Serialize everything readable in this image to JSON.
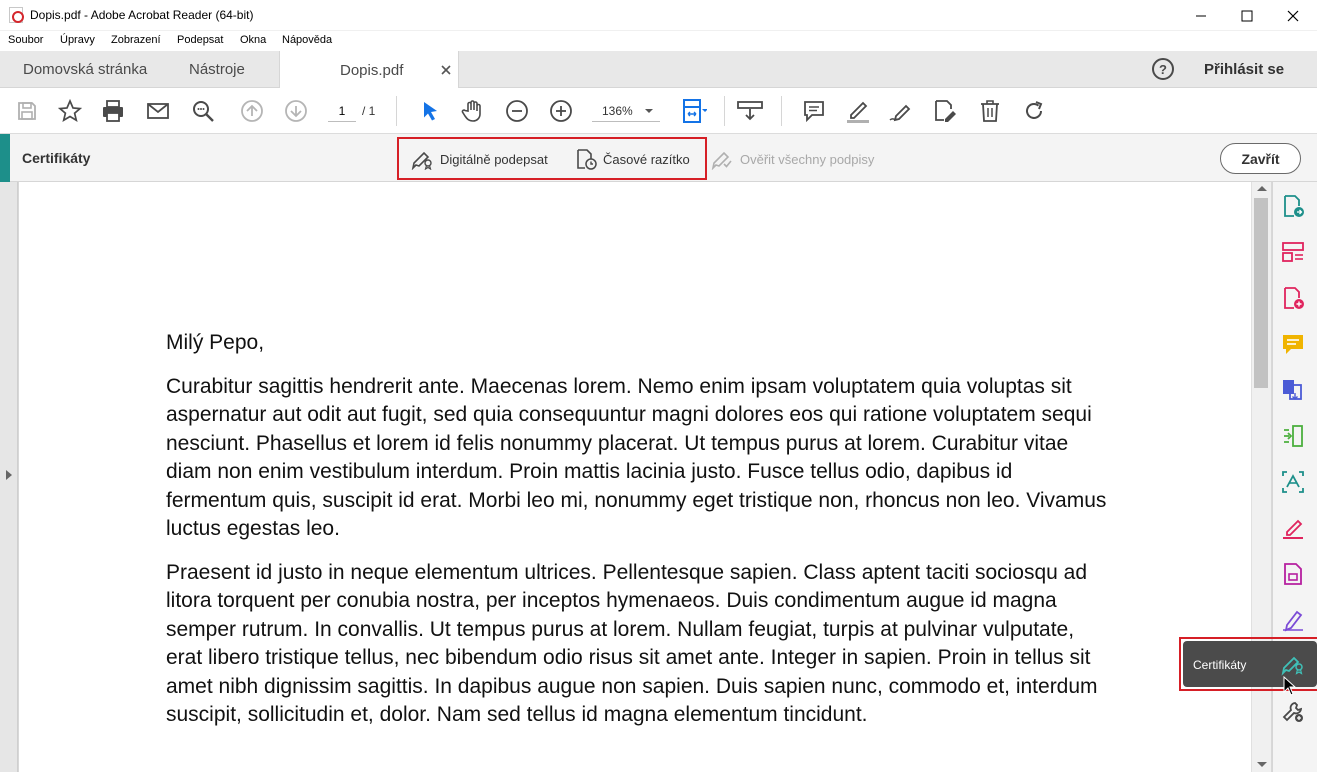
{
  "window": {
    "title": "Dopis.pdf - Adobe Acrobat Reader (64-bit)"
  },
  "menu": {
    "items": [
      "Soubor",
      "Úpravy",
      "Zobrazení",
      "Podepsat",
      "Okna",
      "Nápověda"
    ]
  },
  "tabs": {
    "home": "Domovská stránka",
    "tools": "Nástroje",
    "document": "Dopis.pdf",
    "help_symbol": "?",
    "signin": "Přihlásit se"
  },
  "toolbar": {
    "page_current": "1",
    "page_total": "/ 1",
    "zoom": "136%"
  },
  "certbar": {
    "title": "Certifikáty",
    "sign_digitally": "Digitálně podepsat",
    "timestamp": "Časové razítko",
    "verify_all": "Ověřit všechny podpisy",
    "close": "Zavřít"
  },
  "document": {
    "greeting": "Milý Pepo,",
    "paragraph1": "Curabitur sagittis hendrerit ante. Maecenas lorem. Nemo enim ipsam voluptatem quia voluptas sit aspernatur aut odit aut fugit, sed quia consequuntur magni dolores eos qui ratione voluptatem sequi nesciunt. Phasellus et lorem id felis nonummy placerat. Ut tempus purus at lorem. Curabitur vitae diam non enim vestibulum interdum. Proin mattis lacinia justo. Fusce tellus odio, dapibus id fermentum quis, suscipit id erat. Morbi leo mi, nonummy eget tristique non, rhoncus non leo. Vivamus luctus egestas leo.",
    "paragraph2": "Praesent id justo in neque elementum ultrices. Pellentesque sapien. Class aptent taciti sociosqu ad litora torquent per conubia nostra, per inceptos hymenaeos. Duis condimentum augue id magna semper rutrum. In convallis. Ut tempus purus at lorem. Nullam feugiat, turpis at pulvinar vulputate, erat libero tristique tellus, nec bibendum odio risus sit amet ante. Integer in sapien. Proin in tellus sit amet nibh dignissim sagittis. In dapibus augue non sapien. Duis sapien nunc, commodo et, interdum suscipit, sollicitudin et, dolor. Nam sed tellus id magna elementum tincidunt."
  },
  "tooltip": {
    "label": "Certifikáty"
  },
  "colors": {
    "accent_teal": "#1d8f8a",
    "highlight_red": "#d61f26",
    "pdf_red": "#d4262c",
    "toolbar_blue": "#1473e6"
  },
  "icons": {
    "toolbar": [
      "save-icon",
      "bookmark-star-icon",
      "print-icon",
      "email-icon",
      "search-zoom-icon",
      "page-up-icon",
      "page-down-icon",
      "select-cursor-icon",
      "hand-icon",
      "zoom-out-icon",
      "zoom-in-icon",
      "fit-page-icon",
      "scroll-mode-icon",
      "comment-icon",
      "highlight-pen-icon",
      "sign-icon",
      "edit-text-icon",
      "delete-icon",
      "rotate-icon"
    ],
    "right_panel": [
      "export-pdf-icon",
      "organize-pages-icon",
      "create-pdf-icon",
      "comment-icon",
      "combine-files-icon",
      "compress-icon",
      "scan-icon",
      "fill-sign-icon",
      "protect-icon",
      "request-signature-icon",
      "certificates-icon",
      "more-tools-icon"
    ]
  }
}
